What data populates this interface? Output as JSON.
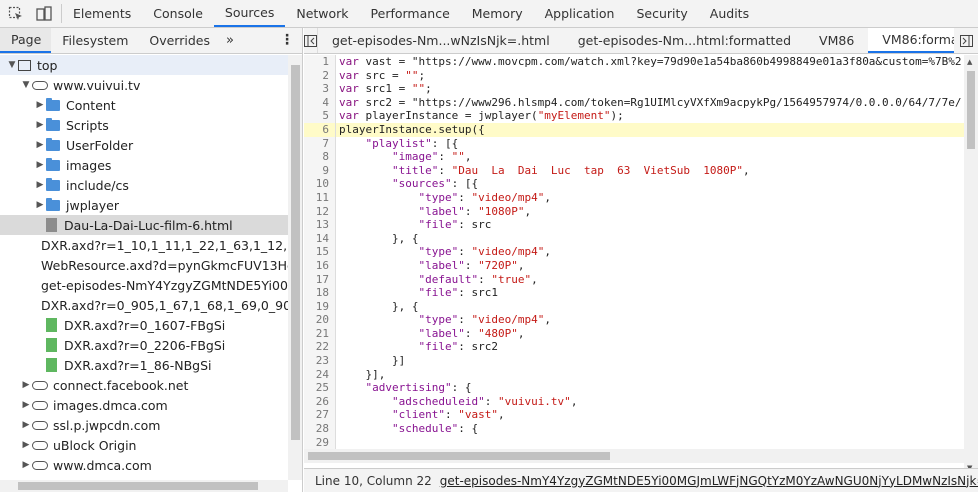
{
  "toolbar": {
    "tabs": [
      "Elements",
      "Console",
      "Sources",
      "Network",
      "Performance",
      "Memory",
      "Application",
      "Security",
      "Audits"
    ],
    "active_tab": "Sources"
  },
  "navigator": {
    "tabs": [
      "Page",
      "Filesystem",
      "Overrides"
    ],
    "more": "»",
    "active_tab": "Page",
    "tree": [
      {
        "label": "top",
        "depth": 0,
        "kind": "frame",
        "arrow": "▼",
        "highlight": true
      },
      {
        "label": "www.vuivui.tv",
        "depth": 1,
        "kind": "cloud",
        "arrow": "▼"
      },
      {
        "label": "Content",
        "depth": 2,
        "kind": "folder",
        "arrow": "▶"
      },
      {
        "label": "Scripts",
        "depth": 2,
        "kind": "folder",
        "arrow": "▶"
      },
      {
        "label": "UserFolder",
        "depth": 2,
        "kind": "folder",
        "arrow": "▶"
      },
      {
        "label": "images",
        "depth": 2,
        "kind": "folder",
        "arrow": "▶"
      },
      {
        "label": "include/cs",
        "depth": 2,
        "kind": "folder",
        "arrow": "▶"
      },
      {
        "label": "jwplayer",
        "depth": 2,
        "kind": "folder",
        "arrow": "▶"
      },
      {
        "label": "Dau-La-Dai-Luc-film-6.html",
        "depth": 2,
        "kind": "file",
        "color": "#8c8c8c",
        "selected": true
      },
      {
        "label": "DXR.axd?r=1_10,1_11,1_22,1_63,1_12,1_13,",
        "depth": 2,
        "kind": "file",
        "color": "#e8c23a"
      },
      {
        "label": "WebResource.axd?d=pynGkmcFUV13He1C",
        "depth": 2,
        "kind": "file",
        "color": "#e8c23a"
      },
      {
        "label": "get-episodes-NmY4YzgyZGMtNDE5Yi00M",
        "depth": 2,
        "kind": "file",
        "color": "#e8c23a"
      },
      {
        "label": "DXR.axd?r=0_905,1_67,1_68,1_69,0_909,0_",
        "depth": 2,
        "kind": "file",
        "color": "#8e5ad4"
      },
      {
        "label": "DXR.axd?r=0_1607-FBgSi",
        "depth": 2,
        "kind": "file",
        "color": "#5fb760"
      },
      {
        "label": "DXR.axd?r=0_2206-FBgSi",
        "depth": 2,
        "kind": "file",
        "color": "#5fb760"
      },
      {
        "label": "DXR.axd?r=1_86-NBgSi",
        "depth": 2,
        "kind": "file",
        "color": "#5fb760"
      },
      {
        "label": "connect.facebook.net",
        "depth": 1,
        "kind": "cloud",
        "arrow": "▶"
      },
      {
        "label": "images.dmca.com",
        "depth": 1,
        "kind": "cloud",
        "arrow": "▶"
      },
      {
        "label": "ssl.p.jwpcdn.com",
        "depth": 1,
        "kind": "cloud",
        "arrow": "▶"
      },
      {
        "label": "uBlock Origin",
        "depth": 1,
        "kind": "cloud",
        "arrow": "▶"
      },
      {
        "label": "www.dmca.com",
        "depth": 1,
        "kind": "cloud",
        "arrow": "▶"
      }
    ]
  },
  "editor": {
    "tabs": [
      {
        "label": "get-episodes-Nm...wNzIsNjk=.html",
        "active": false
      },
      {
        "label": "get-episodes-Nm...html:formatted",
        "active": false
      },
      {
        "label": "VM86",
        "active": false
      },
      {
        "label": "VM86:formatted",
        "active": true,
        "closable": true
      }
    ],
    "close_glyph": "×",
    "highlight_line": 6,
    "lines": [
      "var vast = \"https://www.movcpm.com/watch.xml?key=79d90e1a54ba860b4998849e01a3f80a&custom=%7B%2",
      "var src = \"\";",
      "var src1 = \"\";",
      "var src2 = \"https://www296.hlsmp4.com/token=Rg1UIMlcyVXfXm9acpykPg/1564957974/0.0.0.0/64/7/7e/",
      "var playerInstance = jwplayer(\"myElement\");",
      "playerInstance.setup({",
      "    \"playlist\": [{",
      "        \"image\": \"\",",
      "        \"title\": \"Dau  La  Dai  Luc  tap  63  VietSub  1080P\",",
      "        \"sources\": [{",
      "            \"type\": \"video/mp4\",",
      "            \"label\": \"1080P\",",
      "            \"file\": src",
      "        }, {",
      "            \"type\": \"video/mp4\",",
      "            \"label\": \"720P\",",
      "            \"default\": \"true\",",
      "            \"file\": src1",
      "        }, {",
      "            \"type\": \"video/mp4\",",
      "            \"label\": \"480P\",",
      "            \"file\": src2",
      "        }]",
      "    }],",
      "    \"advertising\": {",
      "        \"adscheduleid\": \"vuivui.tv\",",
      "        \"client\": \"vast\",",
      "        \"schedule\": {",
      ""
    ]
  },
  "status": {
    "position": "Line 10, Column 22",
    "source_link": "get-episodes-NmY4YzgyZGMtNDE5Yi00MGJmLWFjNGQtYzM0YzAwNGU0NjYyLDMwNzIsNjk=.html:form"
  }
}
